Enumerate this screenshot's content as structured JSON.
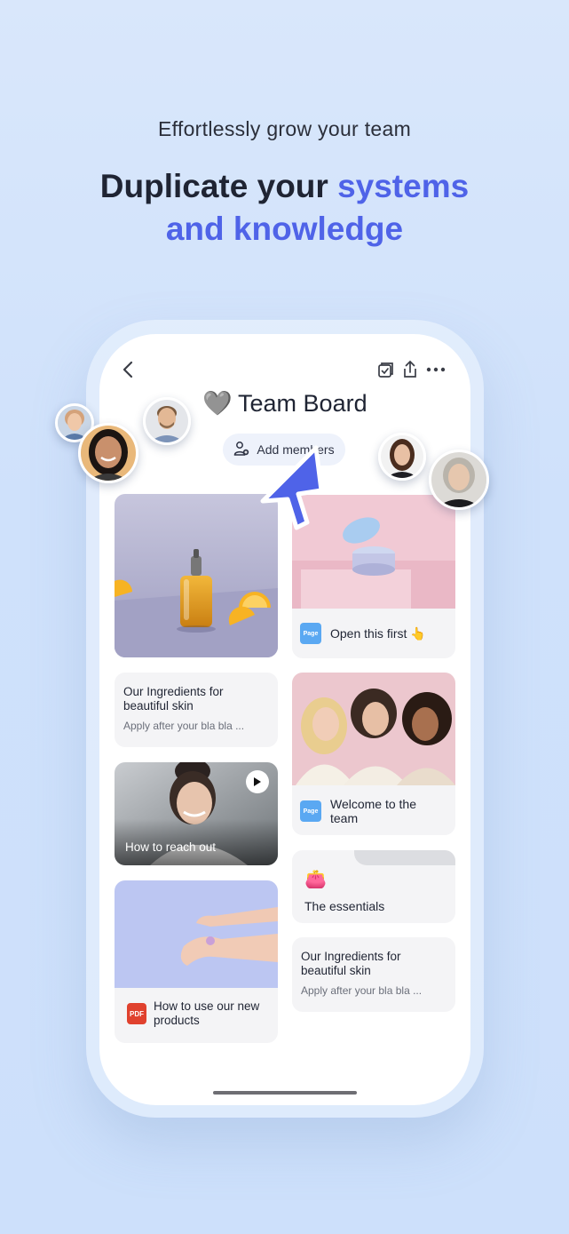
{
  "header": {
    "tagline": "Effortlessly grow your team",
    "headline_part1": "Duplicate your ",
    "headline_accent1": "systems",
    "headline_accent2": "and knowledge",
    "accent_color": "#4f63e8"
  },
  "board": {
    "title": "Team Board",
    "heart": "🩶",
    "add_members_label": "Add members"
  },
  "cards": {
    "serum_image_alt": "serum bottle with lemons",
    "ingredients_left": {
      "title": "Our Ingredients for beautiful skin",
      "subtitle": "Apply after your bla bla ..."
    },
    "video": {
      "title": "How to reach out"
    },
    "pdf": {
      "badge": "PDF",
      "title": "How to use our new products"
    },
    "open_first": {
      "badge": "Page",
      "title": "Open this first 👆"
    },
    "welcome": {
      "badge": "Page",
      "title": "Welcome to the team"
    },
    "essentials": {
      "emoji": "👛",
      "title": "The essentials"
    },
    "ingredients_right": {
      "title": "Our Ingredients for beautiful skin",
      "subtitle": "Apply after your bla bla ..."
    }
  }
}
